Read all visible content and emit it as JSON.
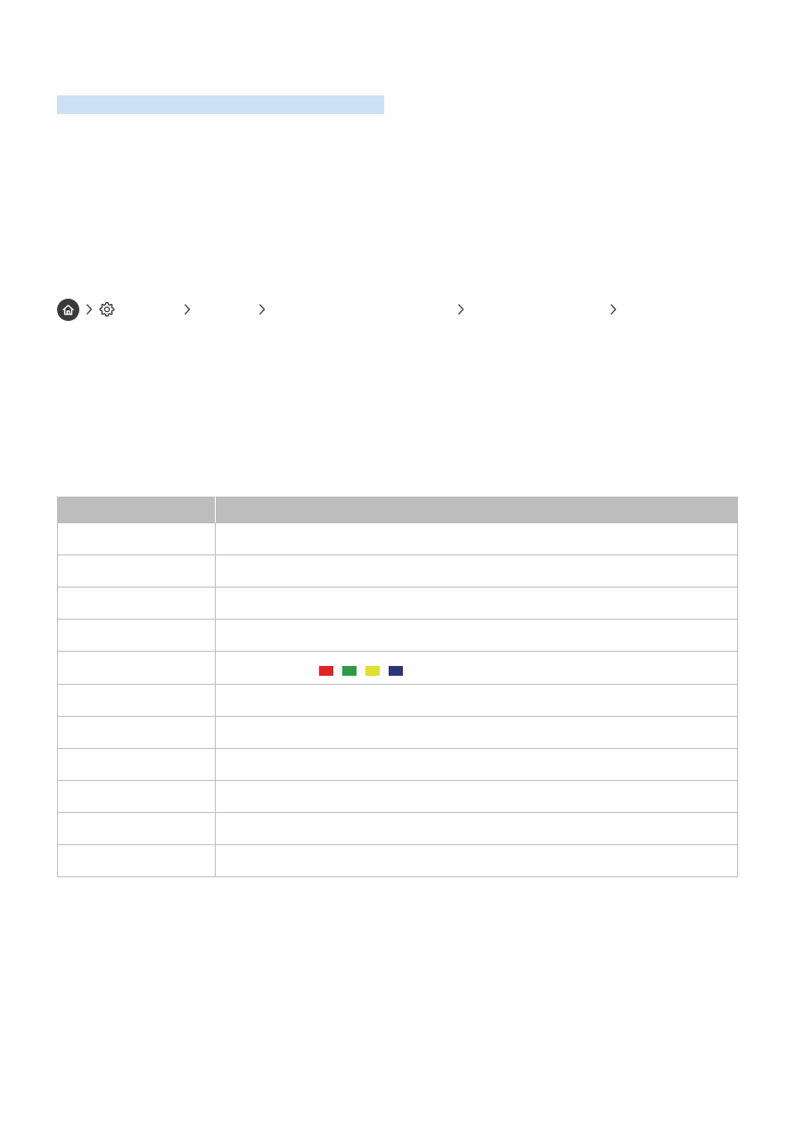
{
  "page": {
    "heading_bar_color": "#cce0f5"
  },
  "breadcrumb": {
    "home_icon": "home-icon",
    "settings_icon": "gear-icon",
    "separator_icon": "chevron-right-icon",
    "items": [
      "",
      "",
      "",
      ""
    ]
  },
  "table": {
    "header": [
      "",
      ""
    ],
    "header_color": "#bdbdbd",
    "rows": [
      {
        "key": "",
        "value": ""
      },
      {
        "key": "",
        "value": ""
      },
      {
        "key": "",
        "value": ""
      },
      {
        "key": "",
        "value": ""
      },
      {
        "key": "",
        "value": "",
        "color_buttons": [
          {
            "name": "red-button",
            "color": "#e02424"
          },
          {
            "name": "green-button",
            "color": "#2e9a45"
          },
          {
            "name": "yellow-button",
            "color": "#e0e030"
          },
          {
            "name": "blue-button",
            "color": "#2d3579"
          }
        ]
      },
      {
        "key": "",
        "value": ""
      },
      {
        "key": "",
        "value": ""
      },
      {
        "key": "",
        "value": ""
      },
      {
        "key": "",
        "value": ""
      },
      {
        "key": "",
        "value": ""
      },
      {
        "key": "",
        "value": ""
      }
    ]
  }
}
